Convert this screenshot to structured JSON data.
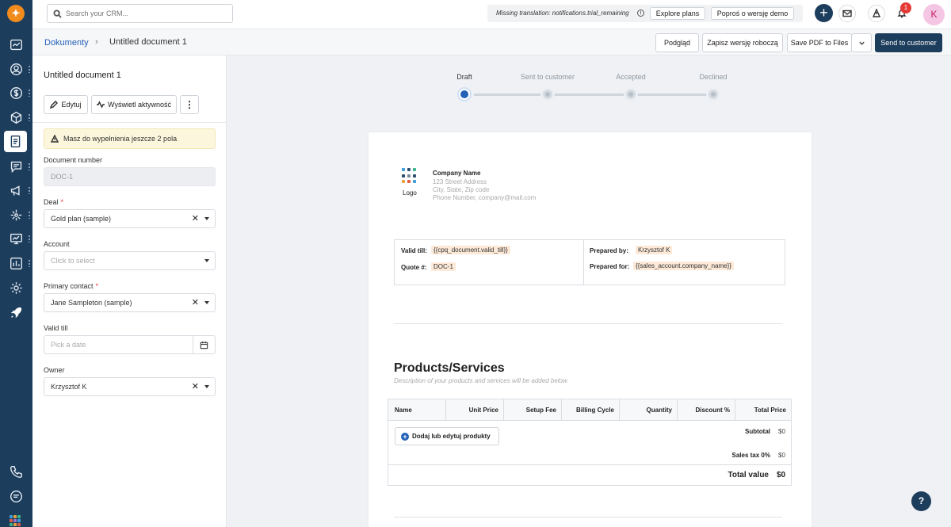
{
  "rail": {
    "logo": "✦",
    "items": [
      {
        "icon": "dashboard-icon"
      },
      {
        "icon": "contacts-icon"
      },
      {
        "icon": "deals-icon"
      },
      {
        "icon": "products-icon"
      },
      {
        "icon": "documents-icon",
        "active": true
      },
      {
        "icon": "conversations-icon"
      },
      {
        "icon": "campaigns-icon"
      },
      {
        "icon": "automation-icon"
      },
      {
        "icon": "analytics-icon"
      },
      {
        "icon": "reports-icon"
      },
      {
        "icon": "settings-icon"
      },
      {
        "icon": "rocket-icon"
      },
      {
        "icon": "phone-icon"
      },
      {
        "icon": "chat-icon"
      },
      {
        "icon": "apps-grid-icon"
      }
    ]
  },
  "topbar": {
    "search_placeholder": "Search your CRM...",
    "trial_text": "Missing translation: notifications.trial_remaining",
    "explore_label": "Explore plans",
    "demo_label": "Poproś o wersję demo",
    "notif_count": "1",
    "avatar_initial": "K"
  },
  "breadcrumb": {
    "parent": "Dokumenty",
    "separator": "›",
    "current": "Untitled document 1"
  },
  "header_actions": {
    "preview": "Podgląd",
    "save_draft": "Zapisz wersję roboczą",
    "save_pdf": "Save PDF to Files",
    "send": "Send to customer"
  },
  "panel": {
    "title": "Untitled document 1",
    "edit_label": "Edytuj",
    "activity_label": "Wyświetl aktywność",
    "warning": "Masz do wypełnienia jeszcze 2 pola",
    "fields": {
      "doc_number_label": "Document number",
      "doc_number_value": "DOC-1",
      "deal_label": "Deal",
      "deal_value": "Gold plan (sample)",
      "account_label": "Account",
      "account_placeholder": "Click to select",
      "contact_label": "Primary contact",
      "contact_value": "Jane Sampleton (sample)",
      "valid_label": "Valid till",
      "valid_placeholder": "Pick a date",
      "owner_label": "Owner",
      "owner_value": "Krzysztof K",
      "required_mark": "*",
      "clear_glyph": "✕"
    }
  },
  "steps": [
    {
      "label": "Draft",
      "active": true
    },
    {
      "label": "Sent to customer",
      "active": false
    },
    {
      "label": "Accepted",
      "active": false
    },
    {
      "label": "Declined",
      "active": false
    }
  ],
  "document": {
    "logo_text": "Logo",
    "logo_colors": [
      "#3c9cdc",
      "#2e4d6e",
      "#39b38c",
      "#2e4d6e",
      "#7a8a99",
      "#2e4d6e",
      "#e9a23b",
      "#e05a47",
      "#3c9cdc"
    ],
    "company_name": "Company Name",
    "address": "123 Street Address",
    "city": "City, State, Zip code",
    "phone": "Phone Number, company@mail.com",
    "valid_label": "Valid till:",
    "valid_value": "{{cpq_document.valid_till}}",
    "quote_label": "Quote #:",
    "quote_value": "DOC-1",
    "prepared_by_label": "Prepared by:",
    "prepared_by_value": "Krzysztof K",
    "prepared_for_label": "Prepared for:",
    "prepared_for_value": "{{sales_account.company_name}}",
    "products_title": "Products/Services",
    "products_sub": "Description of your products and services will be added below",
    "columns": [
      "Name",
      "Unit Price",
      "Setup Fee",
      "Billing Cycle",
      "Quantity",
      "Discount %",
      "Total Price"
    ],
    "add_products": "Dodaj lub edytuj produkty",
    "subtotal_label": "Subtotal",
    "subtotal_value": "$0",
    "tax_label": "Sales tax 0%",
    "tax_value": "$0",
    "total_label": "Total value",
    "total_value": "$0"
  },
  "help_label": "?"
}
